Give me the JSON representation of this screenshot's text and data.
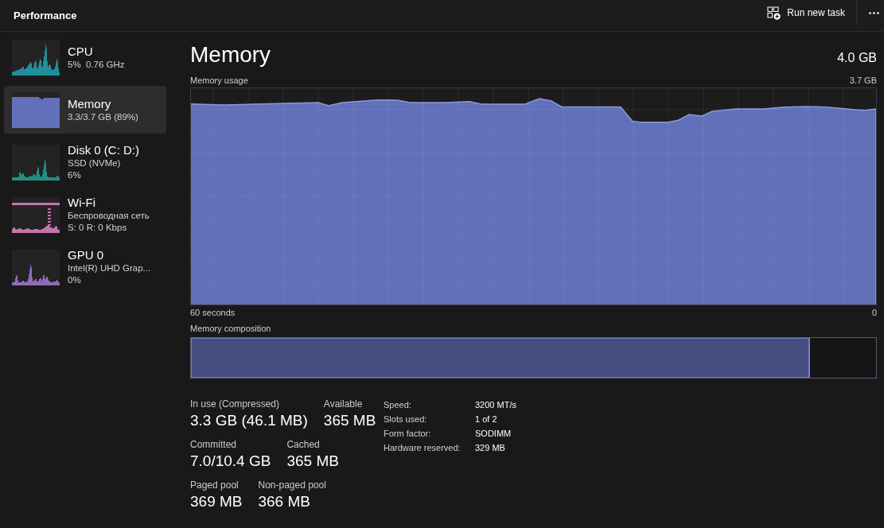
{
  "header": {
    "title": "Performance",
    "run_task_button": {
      "label": "Run new task"
    }
  },
  "sidebar": {
    "items": [
      {
        "kind": "cpu",
        "title": "CPU",
        "details": [
          "5%  0.76 GHz"
        ],
        "color": "#1f8f9d",
        "selected": false
      },
      {
        "kind": "memory",
        "title": "Memory",
        "details": [
          "3.3/3.7 GB (89%)"
        ],
        "color": "#6170b8",
        "selected": true
      },
      {
        "kind": "disk",
        "title": "Disk 0 (C: D:)",
        "details": [
          "SSD (NVMe)",
          "6%"
        ],
        "color": "#1f8f82",
        "selected": false
      },
      {
        "kind": "network",
        "title": "Wi-Fi",
        "details": [
          "Беспроводная сеть",
          "S: 0 R: 0 Kbps"
        ],
        "color": "#c872ac",
        "selected": false
      },
      {
        "kind": "gpu",
        "title": "GPU 0",
        "details": [
          "Intel(R) UHD Grap...",
          "0%"
        ],
        "color": "#9169b8",
        "selected": false
      }
    ]
  },
  "detail": {
    "title": "Memory",
    "total": "4.0 GB",
    "usage_graph": {
      "label": "Memory usage",
      "max_label": "3.7 GB",
      "span_label": "60 seconds",
      "min_label": "0"
    },
    "composition": {
      "label": "Memory composition",
      "level": 0.904
    },
    "stat_rows": [
      {
        "stats": [
          {
            "label": "In use (Compressed)",
            "value": "3.3 GB (46.1 MB)"
          },
          {
            "label": "Available",
            "value": "365 MB"
          }
        ]
      },
      {
        "stats": [
          {
            "label": "Committed",
            "value": "7.0/10.4 GB"
          },
          {
            "label": "Cached",
            "value": "365 MB"
          }
        ]
      },
      {
        "stats": [
          {
            "label": "Paged pool",
            "value": "369 MB"
          },
          {
            "label": "Non-paged pool",
            "value": "366 MB"
          }
        ]
      }
    ],
    "properties": [
      {
        "label": "Speed:",
        "value": "3200 MT/s"
      },
      {
        "label": "Slots used:",
        "value": "1 of 2"
      },
      {
        "label": "Form factor:",
        "value": "SODIMM"
      },
      {
        "label": "Hardware reserved:",
        "value": "329 MB"
      }
    ]
  }
}
